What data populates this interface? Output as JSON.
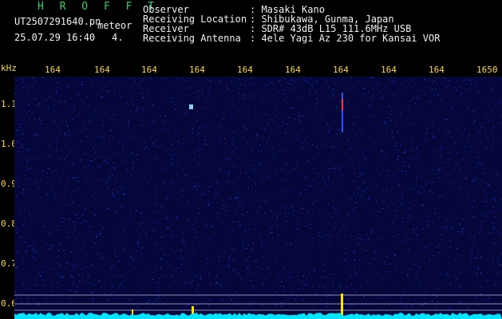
{
  "header": {
    "title": "H R O F F T",
    "filename": "UT2507291640.pn",
    "program": "meteor",
    "timestamp": "25.07.29 16:40",
    "extra": "4.",
    "observer_label": "Observer",
    "observer_value": ": Masaki Kano",
    "location_label": "Receiving Location",
    "location_value": ": Shibukawa, Gunma, Japan",
    "receiver_label": "Receiver",
    "receiver_value": ": SDR# 43dB L15 111.6MHz USB",
    "antenna_label": "Receiving Antenna",
    "antenna_value": ": 4ele Yagi Az 230 for Kansai VOR"
  },
  "axis": {
    "unit": "kHz",
    "xticks": [
      "164",
      "164",
      "164",
      "164",
      "164",
      "164",
      "164",
      "164",
      "164",
      "1650"
    ],
    "yticks": [
      "1.1",
      "1.0",
      "0.9",
      "0.8",
      "0.7",
      "0.6"
    ]
  },
  "colors": {
    "background": "#05063a",
    "noise": "#1a2acb",
    "baseline": "#00e5ff",
    "marker": "#ffe400",
    "text": "#f2f2f2",
    "title": "#35d16b"
  }
}
